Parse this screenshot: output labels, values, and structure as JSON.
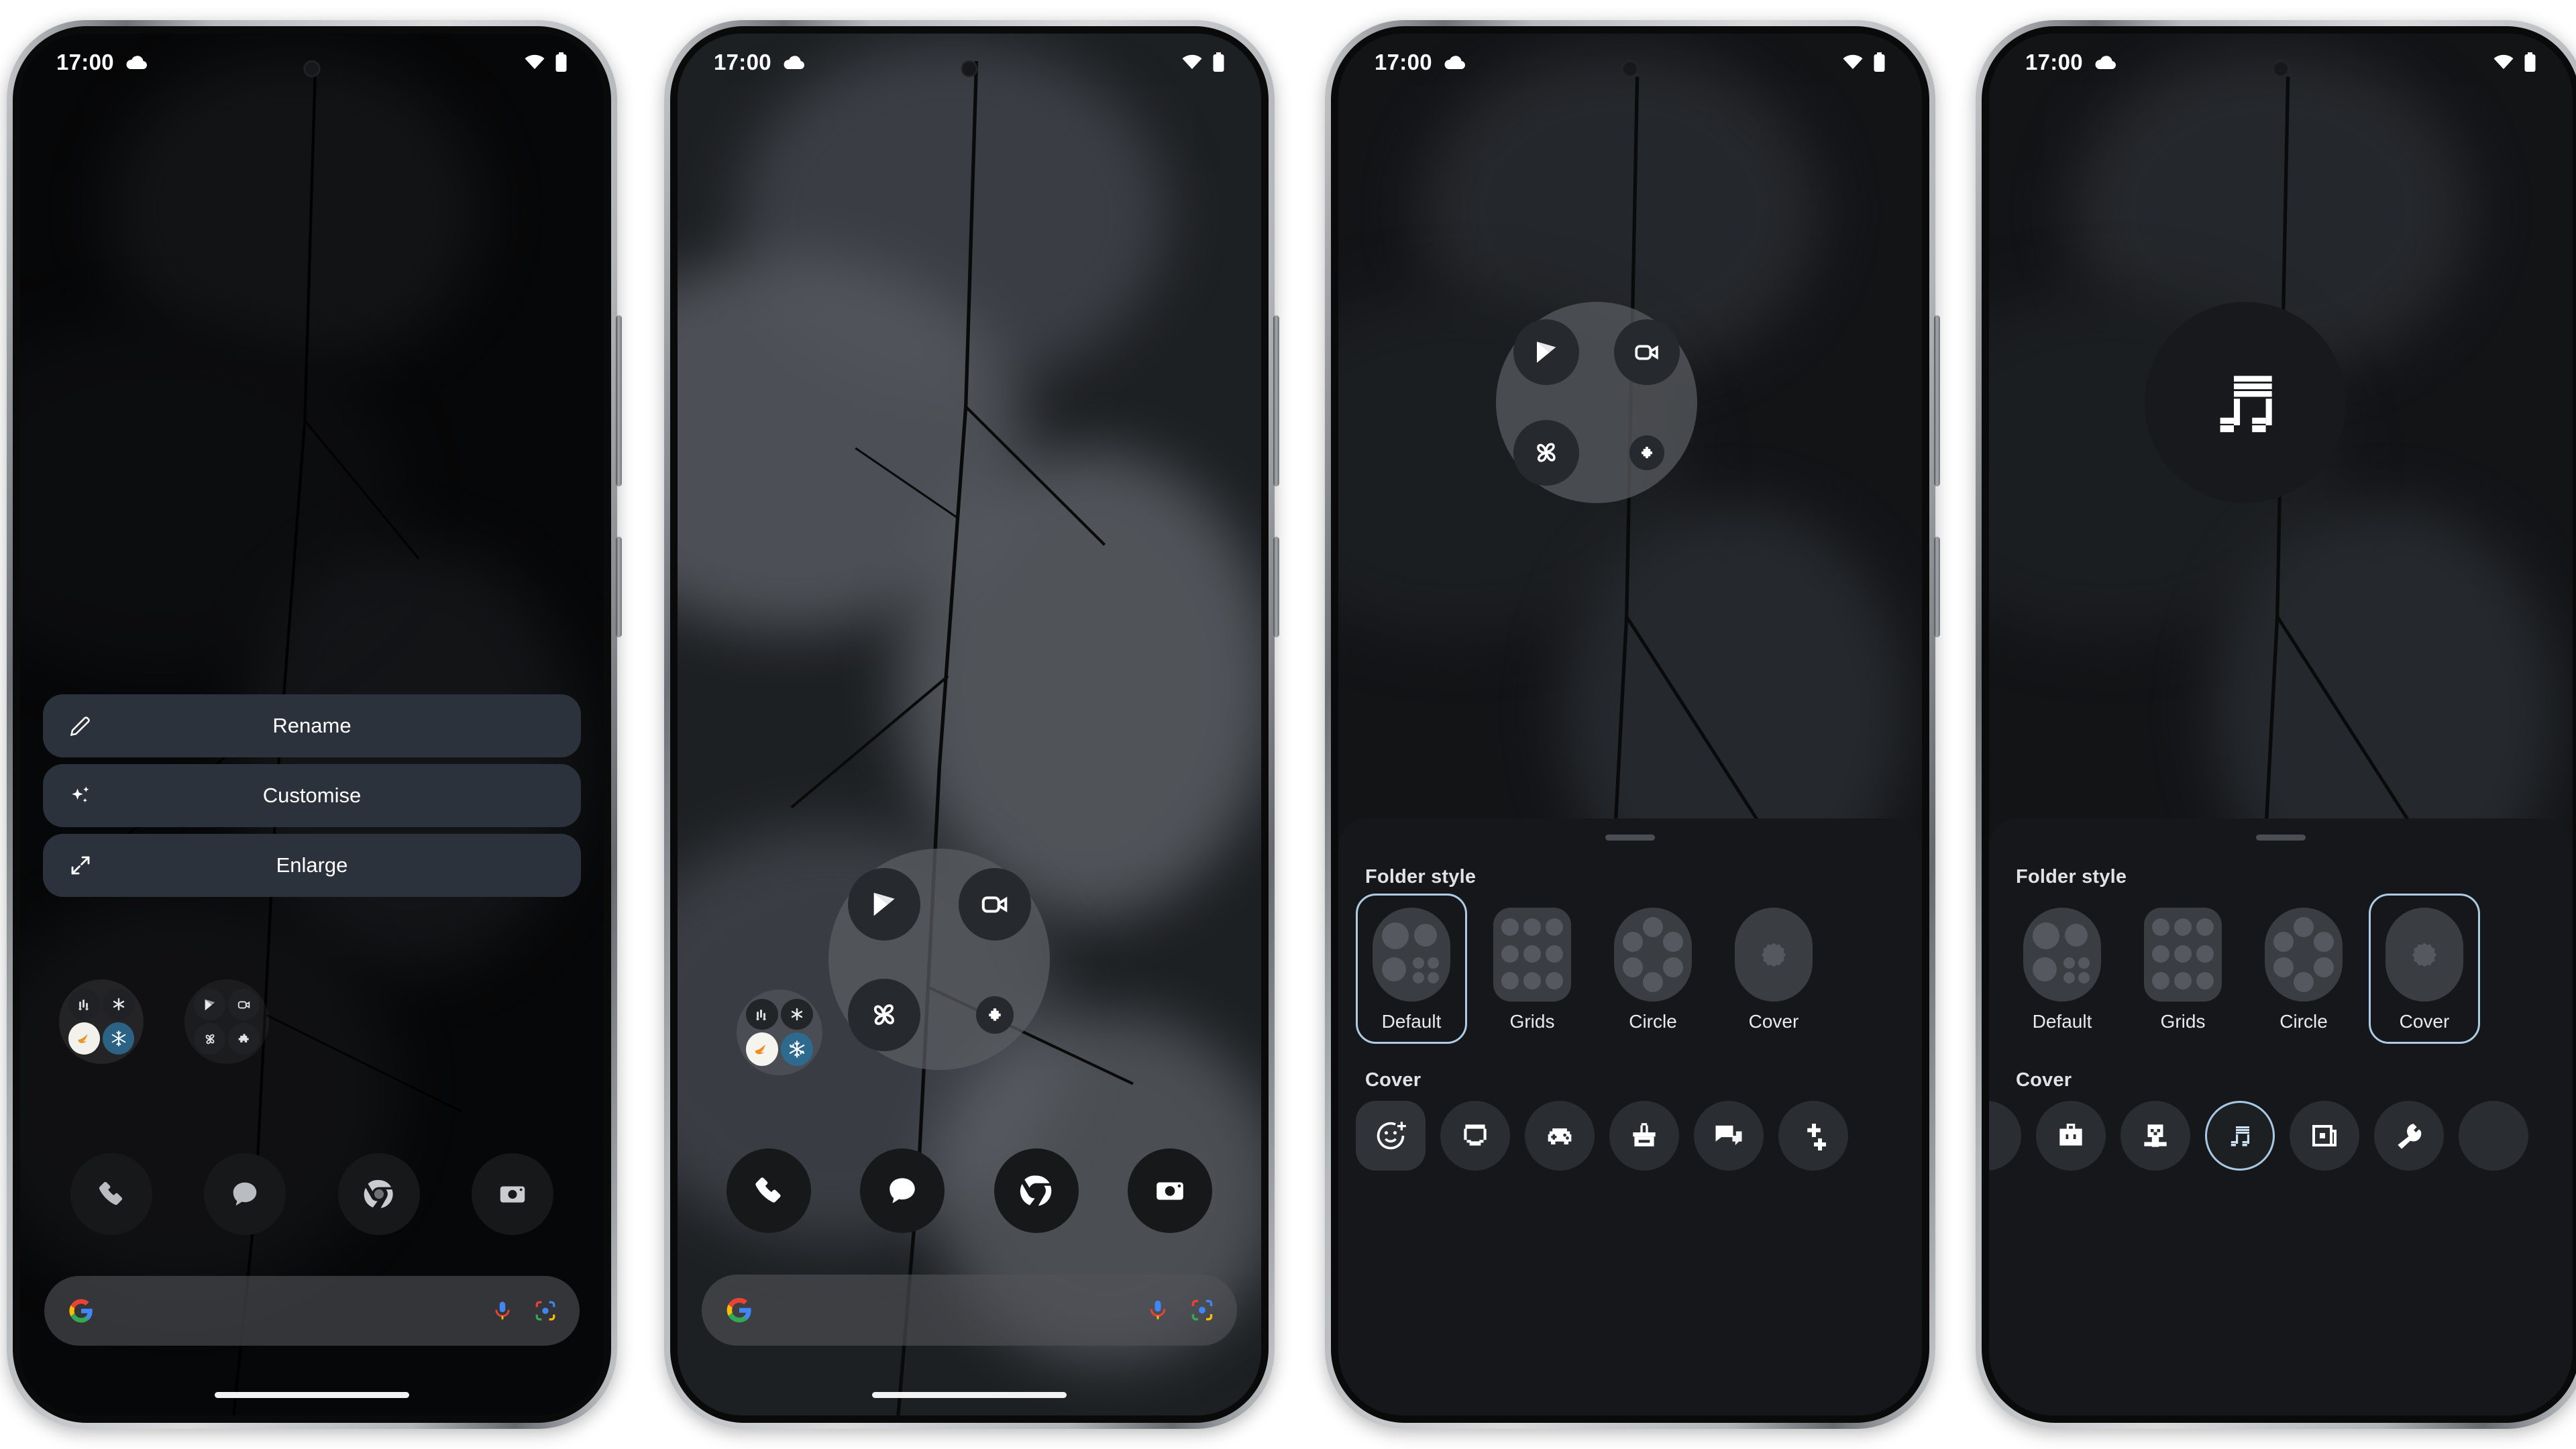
{
  "status_bar": {
    "time": "17:00",
    "weather_icon": "cloud-icon",
    "wifi_icon": "wifi-icon",
    "battery_icon": "battery-icon"
  },
  "phone1": {
    "label": "folder-context-menu-screen",
    "context_menu": [
      {
        "label": "Rename",
        "icon": "pencil-icon"
      },
      {
        "label": "Customise",
        "icon": "sparkle-icon"
      },
      {
        "label": "Enlarge",
        "icon": "expand-arrows-icon"
      }
    ]
  },
  "phone2": {
    "label": "folder-open-screen",
    "open_folder_apps": [
      "play-store-icon",
      "video-camera-icon",
      "photos-pinwheel-icon",
      "puzzle-extension-icon"
    ],
    "closed_folder_apps": [
      "analytics-icon",
      "snowflake-small-icon",
      "bird-logo-icon",
      "snowflake-icon"
    ]
  },
  "phone3": {
    "label": "folder-style-default-screen",
    "open_folder_apps": [
      "play-store-icon",
      "video-camera-icon",
      "photos-pinwheel-icon",
      "puzzle-extension-icon"
    ],
    "sheet": {
      "folder_style_heading": "Folder style",
      "folder_styles": [
        {
          "label": "Default",
          "preview": "default-preview",
          "selected": true
        },
        {
          "label": "Grids",
          "preview": "grids-preview",
          "selected": false
        },
        {
          "label": "Circle",
          "preview": "circle-preview",
          "selected": false
        },
        {
          "label": "Cover",
          "preview": "cover-preview",
          "selected": false
        }
      ],
      "cover_heading": "Cover",
      "cover_icons": [
        {
          "icon": "emoji-add-icon",
          "shape": "square",
          "selected": false
        },
        {
          "icon": "smiley-face-icon",
          "shape": "circle",
          "selected": false
        },
        {
          "icon": "game-controller-icon",
          "shape": "circle",
          "selected": false
        },
        {
          "icon": "shopping-basket-icon",
          "shape": "circle",
          "selected": false
        },
        {
          "icon": "chat-bubbles-icon",
          "shape": "circle",
          "selected": false
        },
        {
          "icon": "sparkle-pixel-icon",
          "shape": "circle",
          "selected": false
        }
      ]
    }
  },
  "phone4": {
    "label": "folder-style-cover-screen",
    "cover_folder_icon": "music-note-pixel-icon",
    "sheet": {
      "folder_style_heading": "Folder style",
      "folder_styles": [
        {
          "label": "Default",
          "preview": "default-preview",
          "selected": false
        },
        {
          "label": "Grids",
          "preview": "grids-preview",
          "selected": false
        },
        {
          "label": "Circle",
          "preview": "circle-preview",
          "selected": false
        },
        {
          "label": "Cover",
          "preview": "cover-preview",
          "selected": true
        }
      ],
      "cover_heading": "Cover",
      "cover_icons": [
        {
          "icon": "partial-left-icon",
          "shape": "circle",
          "selected": false
        },
        {
          "icon": "briefcase-icon",
          "shape": "circle",
          "selected": false
        },
        {
          "icon": "film-reel-icon",
          "shape": "circle",
          "selected": false
        },
        {
          "icon": "music-note-pixel-icon",
          "shape": "circle",
          "selected": true
        },
        {
          "icon": "photo-frame-icon",
          "shape": "circle",
          "selected": false
        },
        {
          "icon": "wrench-icon",
          "shape": "circle",
          "selected": false
        },
        {
          "icon": "partial-right-icon",
          "shape": "circle",
          "selected": false
        }
      ]
    }
  },
  "dock": {
    "apps": [
      "phone-icon",
      "messages-icon",
      "chrome-icon",
      "camera-icon"
    ]
  },
  "search": {
    "google_logo": "google-g-icon",
    "mic_icon": "microphone-icon",
    "lens_icon": "google-lens-icon"
  },
  "colors": {
    "sheet_bg": "#15171a",
    "menu_bg": "#2b323c",
    "accent_selected": "#adcbe3",
    "text_primary": "#ffffff",
    "frame": "#b2b5b8"
  }
}
